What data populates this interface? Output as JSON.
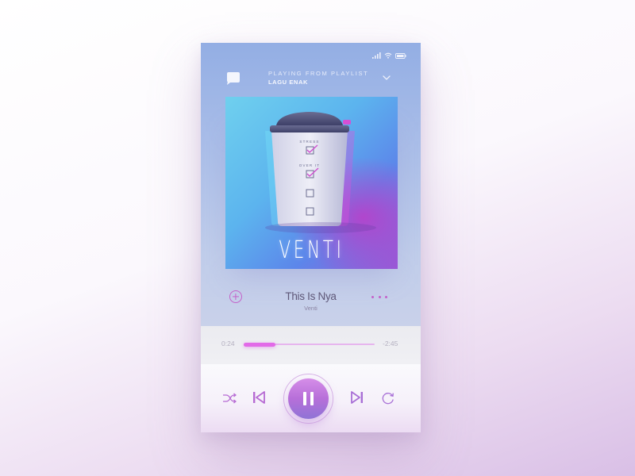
{
  "header": {
    "subtitle": "PLAYING FROM PLAYLIST",
    "playlist_name": "LAGU ENAK"
  },
  "album": {
    "title": "VENTI",
    "checklist_labels": [
      "STRESS",
      "OVER IT"
    ]
  },
  "track": {
    "title": "This Is Nya",
    "artist": "Venti"
  },
  "playback": {
    "elapsed": "0:24",
    "remaining": "-2:45",
    "progress_fraction": 0.24
  },
  "colors": {
    "accent": "#c461c9",
    "progress": "#e26ae8",
    "gradient_top": "#93aee4"
  },
  "icons": [
    "chat-bubble-icon",
    "chevron-down-icon",
    "signal-icon",
    "wifi-icon",
    "battery-icon",
    "add-icon",
    "more-icon",
    "shuffle-icon",
    "previous-icon",
    "pause-icon",
    "next-icon",
    "repeat-icon"
  ]
}
